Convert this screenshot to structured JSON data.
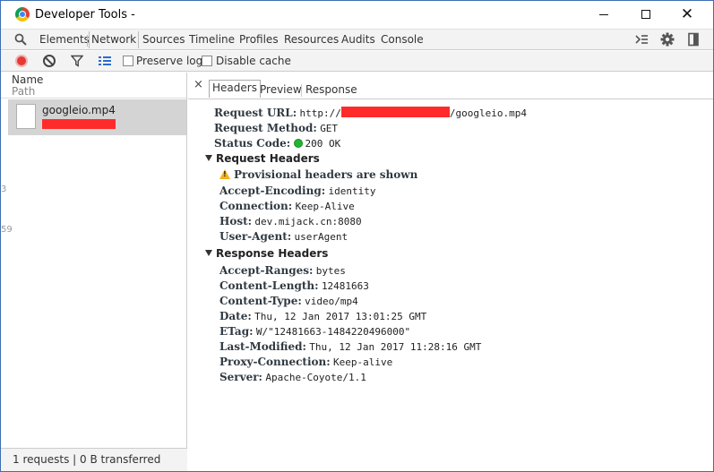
{
  "window": {
    "title": "Developer Tools -"
  },
  "tabs": {
    "items": [
      {
        "label": "Elements"
      },
      {
        "label": "Network"
      },
      {
        "label": "Sources"
      },
      {
        "label": "Timeline"
      },
      {
        "label": "Profiles"
      },
      {
        "label": "Resources"
      },
      {
        "label": "Audits"
      },
      {
        "label": "Console"
      }
    ],
    "right_icons": [
      "drawer-toggle-icon",
      "gear-icon",
      "dock-icon"
    ]
  },
  "toolbar": {
    "preserve_log": "Preserve log",
    "disable_cache": "Disable cache"
  },
  "request_list": {
    "col_name": "Name",
    "col_path": "Path",
    "items": [
      {
        "name": "googleio.mp4"
      }
    ],
    "gutter": [
      "3",
      "59"
    ],
    "status": "1 requests | 0 B transferred"
  },
  "detail": {
    "close_symbol": "×",
    "tabs": [
      "Headers",
      "Preview",
      "Response"
    ],
    "general": [
      {
        "key": "Request URL:",
        "pre": "http://",
        "post": "/googleio.mp4"
      },
      {
        "key": "Request Method:",
        "value": "GET"
      },
      {
        "key": "Status Code:",
        "value": "200 OK"
      }
    ],
    "request_headers_title": "Request Headers",
    "provisional": "Provisional headers are shown",
    "request_headers": [
      {
        "key": "Accept-Encoding:",
        "value": "identity"
      },
      {
        "key": "Connection:",
        "value": "Keep-Alive"
      },
      {
        "key": "Host:",
        "value": "dev.mijack.cn:8080"
      },
      {
        "key": "User-Agent:",
        "value": "userAgent"
      }
    ],
    "response_headers_title": "Response Headers",
    "response_headers": [
      {
        "key": "Accept-Ranges:",
        "value": "bytes"
      },
      {
        "key": "Content-Length:",
        "value": "12481663"
      },
      {
        "key": "Content-Type:",
        "value": "video/mp4"
      },
      {
        "key": "Date:",
        "value": "Thu, 12 Jan 2017 13:01:25 GMT"
      },
      {
        "key": "ETag:",
        "value": "W/\"12481663-1484220496000\""
      },
      {
        "key": "Last-Modified:",
        "value": "Thu, 12 Jan 2017 11:28:16 GMT"
      },
      {
        "key": "Proxy-Connection:",
        "value": "Keep-alive"
      },
      {
        "key": "Server:",
        "value": "Apache-Coyote/1.1"
      }
    ]
  },
  "colors": {
    "record": "#e53935",
    "redaction": "#ff2b2b",
    "status_ok": "#22b531",
    "warning": "#f3b01c"
  }
}
